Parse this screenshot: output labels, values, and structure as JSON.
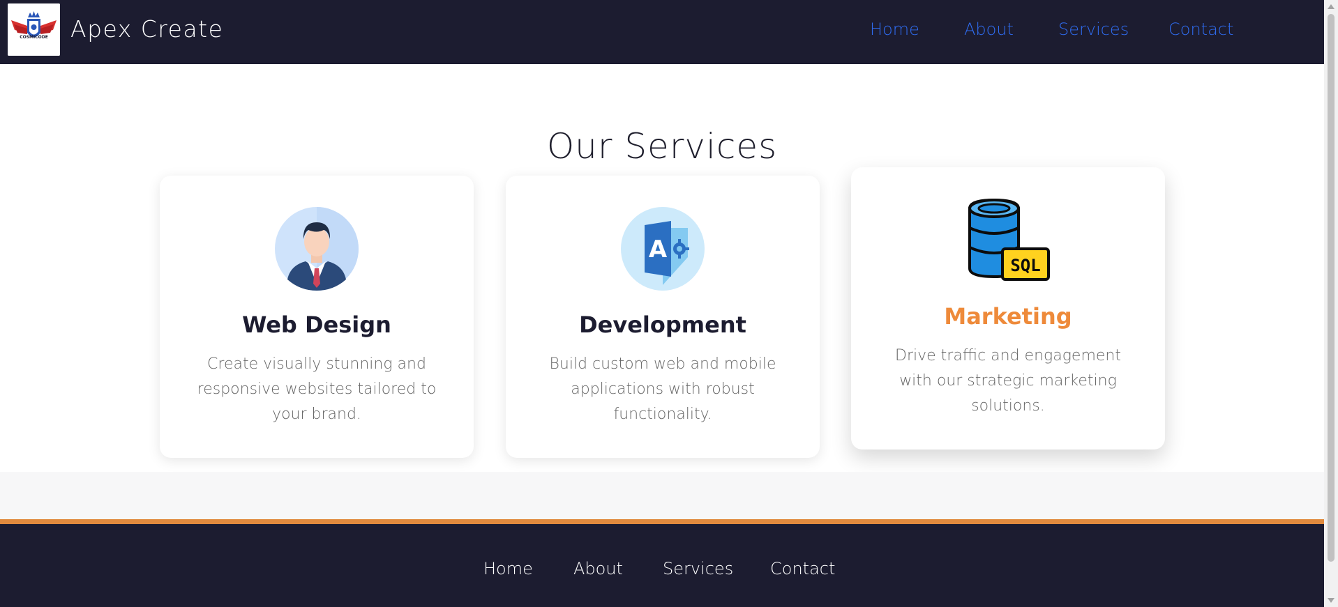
{
  "header": {
    "brand": "Apex Create",
    "logo_text": "COSMICODE",
    "nav": [
      "Home",
      "About",
      "Services",
      "Contact"
    ]
  },
  "services": {
    "title": "Our Services",
    "cards": [
      {
        "title": "Web Design",
        "description": "Create visually stunning and responsive websites tailored to your brand.",
        "icon": "businessman-icon"
      },
      {
        "title": "Development",
        "description": "Build custom web and mobile applications with robust functionality.",
        "icon": "app-settings-icon"
      },
      {
        "title": "Marketing",
        "description": "Drive traffic and engagement with our strategic marketing solutions.",
        "icon": "sql-database-icon",
        "icon_label": "SQL"
      }
    ]
  },
  "footer": {
    "nav": [
      "Home",
      "About",
      "Services",
      "Contact"
    ]
  },
  "colors": {
    "header_bg": "#1c1c30",
    "nav_link": "#2f6cf0",
    "accent": "#e08a3e",
    "featured_title": "#ee8a3a"
  }
}
